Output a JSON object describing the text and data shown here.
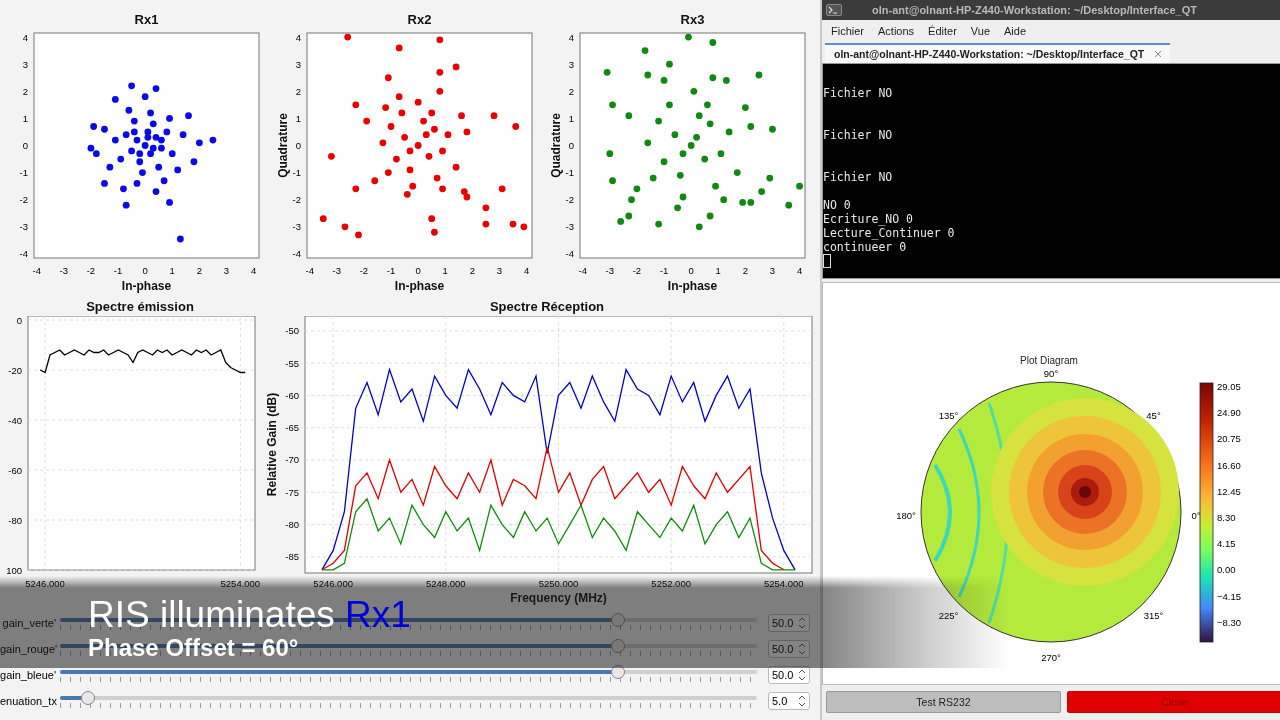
{
  "constellations": [
    {
      "chart_data": {
        "type": "scatter",
        "title": "Rx1",
        "xlabel": "In-phase",
        "xlim": [
          -4.1,
          4.2
        ],
        "ylim": [
          -4.15,
          4.15
        ],
        "xticks": [
          {
            "value": -4,
            "label": "-4"
          },
          {
            "value": -3,
            "label": "-3"
          },
          {
            "value": -2,
            "label": "-2"
          },
          {
            "value": -1,
            "label": "-1"
          },
          {
            "value": 0,
            "label": "0"
          },
          {
            "value": 1,
            "label": "1"
          },
          {
            "value": 2,
            "label": "2"
          },
          {
            "value": 3,
            "label": "3"
          },
          {
            "value": 4,
            "label": "4"
          }
        ],
        "yticks": [
          {
            "value": -4,
            "label": "-4"
          },
          {
            "value": -3,
            "label": "-3"
          },
          {
            "value": -2,
            "label": "-2"
          },
          {
            "value": -1,
            "label": "-1"
          },
          {
            "value": 0,
            "label": "0"
          },
          {
            "value": 1,
            "label": "1"
          },
          {
            "value": 2,
            "label": "2"
          },
          {
            "value": 3,
            "label": "3"
          },
          {
            "value": 4,
            "label": "4"
          }
        ],
        "series": [
          {
            "color": "#0a0ae6",
            "x": [
              0,
              -0.3,
              0.2,
              0.4,
              -0.5,
              0.1,
              -0.2,
              0.6,
              -0.7,
              0.3,
              -0.4,
              0.8,
              -0.9,
              0.5,
              -0.1,
              1.0,
              -1.1,
              0.2,
              -0.6,
              0.9,
              -1.3,
              0.7,
              -0.3,
              1.4,
              -1.5,
              1.2,
              -0.8,
              0.4,
              -0.5,
              0.4,
              -1.1,
              1.6,
              -1.8,
              2.0,
              2.5,
              -2.0,
              1.8,
              -0.7,
              0.9,
              -1.5,
              0.0,
              1.3,
              -1.9,
              0.1,
              -0.2,
              0.3,
              -0.4,
              0.6
            ],
            "values": [
              0,
              0.2,
              -0.3,
              0.3,
              -0.2,
              0.5,
              -0.6,
              -0.1,
              0.4,
              0.8,
              0.9,
              0.5,
              -0.5,
              -0.8,
              -1.0,
              -0.3,
              0.2,
              1.2,
              1.3,
              1.0,
              -0.8,
              -1.3,
              -1.4,
              0.4,
              0.6,
              -0.9,
              -1.6,
              -1.7,
              2.2,
              2.1,
              1.7,
              1.1,
              -0.3,
              0.1,
              0.2,
              -0.1,
              -0.6,
              -2.2,
              -2.1,
              -1.4,
              1.8,
              -3.45,
              0.7,
              0.3,
              -0.3,
              -0.1,
              0.5,
              0.2
            ]
          }
        ]
      }
    },
    {
      "chart_data": {
        "type": "scatter",
        "title": "Rx2",
        "xlabel": "In-phase",
        "ylabel": "Quadrature",
        "xlim": [
          -4.1,
          4.2
        ],
        "ylim": [
          -4.15,
          4.15
        ],
        "xticks": [
          {
            "value": -4,
            "label": "-4"
          },
          {
            "value": -3,
            "label": "-3"
          },
          {
            "value": -2,
            "label": "-2"
          },
          {
            "value": -1,
            "label": "-1"
          },
          {
            "value": 0,
            "label": "0"
          },
          {
            "value": 1,
            "label": "1"
          },
          {
            "value": 2,
            "label": "2"
          },
          {
            "value": 3,
            "label": "3"
          },
          {
            "value": 4,
            "label": "4"
          }
        ],
        "yticks": [
          {
            "value": -4,
            "label": "-4"
          },
          {
            "value": -3,
            "label": "-3"
          },
          {
            "value": -2,
            "label": "-2"
          },
          {
            "value": -1,
            "label": "-1"
          },
          {
            "value": 0,
            "label": "0"
          },
          {
            "value": 1,
            "label": "1"
          },
          {
            "value": 2,
            "label": "2"
          },
          {
            "value": 3,
            "label": "3"
          },
          {
            "value": 4,
            "label": "4"
          }
        ],
        "series": [
          {
            "color": "#e60000",
            "x": [
              0,
              -0.5,
              0.4,
              0.6,
              -0.8,
              0.2,
              -0.3,
              0.9,
              -1.0,
              0.5,
              -0.6,
              1.1,
              -1.1,
              0.7,
              -0.2,
              1.4,
              -1.3,
              0.0,
              -0.7,
              1.6,
              -1.6,
              0.9,
              -0.4,
              1.8,
              -1.9,
              1.7,
              -1.2,
              0.8,
              -1.1,
              0.8,
              1.4,
              -0.7,
              0.8,
              -2.6,
              -2.3,
              -3.2,
              -3.5,
              -2.7,
              -2.2,
              2.8,
              3.6,
              3.1,
              2.5,
              2.5,
              3.5,
              3.9,
              0.5,
              0.6,
              -2.3,
              1.8,
              0.3,
              -0.3
            ],
            "values": [
              0,
              0.3,
              -0.4,
              0.6,
              -0.5,
              0.9,
              -0.9,
              -0.2,
              0.7,
              1.2,
              1.2,
              0.4,
              -1.0,
              -1.2,
              -1.5,
              -0.8,
              0.1,
              1.6,
              1.8,
              1.1,
              -1.3,
              -1.6,
              -1.8,
              0.5,
              0.9,
              -1.7,
              1.4,
              2.0,
              2.5,
              2.7,
              2.9,
              3.6,
              3.9,
              4.0,
              1.5,
              -0.4,
              -2.7,
              -3.0,
              -3.3,
              1.1,
              0.7,
              -1.6,
              -2.3,
              -2.9,
              -2.9,
              -3.0,
              -2.7,
              -3.2,
              -1.6,
              -1.9,
              0.4,
              -0.2
            ]
          }
        ]
      }
    },
    {
      "chart_data": {
        "type": "scatter",
        "title": "Rx3",
        "xlabel": "In-phase",
        "ylabel": "Quadrature",
        "xlim": [
          -4.1,
          4.2
        ],
        "ylim": [
          -4.15,
          4.15
        ],
        "xticks": [
          {
            "value": -4,
            "label": "-4"
          },
          {
            "value": -3,
            "label": "-3"
          },
          {
            "value": -2,
            "label": "-2"
          },
          {
            "value": -1,
            "label": "-1"
          },
          {
            "value": 0,
            "label": "0"
          },
          {
            "value": 1,
            "label": "1"
          },
          {
            "value": 2,
            "label": "2"
          },
          {
            "value": 3,
            "label": "3"
          },
          {
            "value": 4,
            "label": "4"
          }
        ],
        "yticks": [
          {
            "value": -4,
            "label": "-4"
          },
          {
            "value": -3,
            "label": "-3"
          },
          {
            "value": -2,
            "label": "-2"
          },
          {
            "value": -1,
            "label": "-1"
          },
          {
            "value": 0,
            "label": "0"
          },
          {
            "value": 1,
            "label": "1"
          },
          {
            "value": 2,
            "label": "2"
          },
          {
            "value": 3,
            "label": "3"
          },
          {
            "value": 4,
            "label": "4"
          }
        ],
        "series": [
          {
            "color": "#118811",
            "x": [
              0,
              -0.6,
              0.5,
              0.7,
              -1.0,
              0.3,
              -0.4,
              1.1,
              -1.2,
              0.6,
              -0.8,
              1.4,
              -1.4,
              0.9,
              -0.3,
              1.7,
              -1.6,
              0.1,
              -1.0,
              2.0,
              -2.0,
              1.2,
              -0.5,
              2.2,
              -2.3,
              2.2,
              -1.6,
              0.8,
              1.3,
              -0.8,
              0.8,
              -0.1,
              -1.7,
              -3.1,
              -2.9,
              -3.0,
              -2.9,
              -2.6,
              -2.3,
              -1.2,
              0.3,
              0.7,
              2.5,
              3.0,
              2.9,
              3.6,
              4.0,
              1.9,
              -2.2,
              2.6,
              0.2,
              -0.3
            ],
            "values": [
              0,
              0.4,
              -0.5,
              0.8,
              -0.6,
              1.1,
              -1.1,
              -0.3,
              0.9,
              1.5,
              1.5,
              0.5,
              -1.2,
              -1.5,
              -1.9,
              -1.0,
              0.1,
              2.0,
              2.4,
              1.4,
              -1.6,
              -2.0,
              -2.3,
              0.7,
              1.1,
              -2.1,
              2.6,
              2.5,
              2.4,
              3.0,
              3.8,
              4.0,
              3.5,
              2.7,
              1.5,
              -0.3,
              -1.3,
              -2.8,
              -2.6,
              -2.9,
              -3.0,
              -2.6,
              2.6,
              0.6,
              -1.2,
              -2.2,
              -1.5,
              -2.1,
              -2.0,
              -1.7,
              0.3,
              -0.3
            ]
          }
        ]
      }
    }
  ],
  "spectrum_tx": {
    "chart_data": {
      "type": "line",
      "title": "Spectre émission",
      "grid": true,
      "xlim": [
        5245.3,
        5254.6
      ],
      "ylim": [
        -100,
        1.6
      ],
      "xticks": [
        {
          "value": 5246,
          "label": "5246.000"
        },
        {
          "value": 5254,
          "label": "5254.000"
        }
      ],
      "yticks": [
        {
          "value": 0,
          "label": "0"
        },
        {
          "value": -20,
          "label": "-20"
        },
        {
          "value": -40,
          "label": "-40"
        },
        {
          "value": -60,
          "label": "-60"
        },
        {
          "value": -80,
          "label": "-80"
        },
        {
          "value": -100,
          "label": "100"
        }
      ],
      "x": [
        5245.8,
        5246.0,
        5246.2,
        5246.4,
        5246.6,
        5246.8,
        5247.0,
        5247.2,
        5247.4,
        5247.6,
        5247.8,
        5248.0,
        5248.2,
        5248.4,
        5248.6,
        5248.8,
        5249.0,
        5249.2,
        5249.4,
        5249.6,
        5249.8,
        5250.0,
        5250.2,
        5250.4,
        5250.6,
        5250.8,
        5251.0,
        5251.2,
        5251.4,
        5251.6,
        5251.8,
        5252.0,
        5252.2,
        5252.4,
        5252.6,
        5252.8,
        5253.0,
        5253.2,
        5253.4,
        5253.6,
        5253.8,
        5254.0,
        5254.2
      ],
      "series": [
        {
          "color": "#000000",
          "values": [
            -20,
            -21,
            -14,
            -13,
            -12,
            -14,
            -13,
            -12,
            -13,
            -14,
            -12,
            -13,
            -13,
            -12,
            -14,
            -13,
            -12,
            -13,
            -14,
            -17,
            -13,
            -12,
            -13,
            -14,
            -12,
            -13,
            -12,
            -14,
            -13,
            -12,
            -13,
            -14,
            -12,
            -13,
            -12,
            -14,
            -13,
            -12,
            -17,
            -19,
            -20,
            -21,
            -21
          ]
        }
      ]
    }
  },
  "spectrum_rx": {
    "chart_data": {
      "type": "line",
      "title": "Spectre Réception",
      "grid": true,
      "xlabel": "Frequency (MHz)",
      "ylabel": "Relative Gain (dB)",
      "xlim": [
        5245.5,
        5254.5
      ],
      "ylim": [
        -87.5,
        -47.7
      ],
      "xticks": [
        {
          "value": 5246,
          "label": "5246.000"
        },
        {
          "value": 5248,
          "label": "5248.000"
        },
        {
          "value": 5250,
          "label": "5250.000"
        },
        {
          "value": 5252,
          "label": "5252.000"
        },
        {
          "value": 5254,
          "label": "5254.000"
        }
      ],
      "yticks": [
        {
          "value": -50,
          "label": "-50"
        },
        {
          "value": -55,
          "label": "-55"
        },
        {
          "value": -60,
          "label": "-60"
        },
        {
          "value": -65,
          "label": "-65"
        },
        {
          "value": -70,
          "label": "-70"
        },
        {
          "value": -75,
          "label": "-75"
        },
        {
          "value": -80,
          "label": "-80"
        },
        {
          "value": -85,
          "label": "-85"
        }
      ],
      "x": [
        5245.8,
        5246.0,
        5246.2,
        5246.4,
        5246.6,
        5246.8,
        5247.0,
        5247.2,
        5247.4,
        5247.6,
        5247.8,
        5248.0,
        5248.2,
        5248.4,
        5248.6,
        5248.8,
        5249.0,
        5249.2,
        5249.4,
        5249.6,
        5249.8,
        5250.0,
        5250.2,
        5250.4,
        5250.6,
        5250.8,
        5251.0,
        5251.2,
        5251.4,
        5251.6,
        5251.8,
        5252.0,
        5252.2,
        5252.4,
        5252.6,
        5252.8,
        5253.0,
        5253.2,
        5253.4,
        5253.6,
        5253.8,
        5254.0,
        5254.2
      ],
      "series": [
        {
          "color": "#0000cc",
          "values": [
            -87,
            -84,
            -78,
            -62,
            -58,
            -63,
            -56,
            -61,
            -59,
            -64,
            -57,
            -60,
            -62,
            -56,
            -59,
            -63,
            -58,
            -60,
            -61,
            -57,
            -69,
            -60,
            -58,
            -62,
            -57,
            -61,
            -64,
            -56,
            -59,
            -60,
            -63,
            -57,
            -61,
            -58,
            -64,
            -60,
            -57,
            -62,
            -59,
            -72,
            -79,
            -84,
            -87
          ]
        },
        {
          "color": "#dd0000",
          "values": [
            -87,
            -86,
            -84,
            -74,
            -72,
            -76,
            -70,
            -75,
            -73,
            -77,
            -71,
            -74,
            -76,
            -72,
            -75,
            -70,
            -77,
            -73,
            -74,
            -76,
            -68,
            -75,
            -72,
            -77,
            -73,
            -71,
            -76,
            -74,
            -72,
            -75,
            -73,
            -77,
            -71,
            -74,
            -76,
            -72,
            -75,
            -73,
            -71,
            -84,
            -86,
            -87,
            null
          ]
        },
        {
          "color": "#128a12",
          "values": [
            -87,
            -87,
            -86,
            -78,
            -76,
            -81,
            -79,
            -83,
            -77,
            -80,
            -82,
            -78,
            -81,
            -79,
            -84,
            -77,
            -80,
            -82,
            -78,
            -81,
            -79,
            -83,
            -80,
            -77,
            -82,
            -79,
            -81,
            -84,
            -78,
            -80,
            -82,
            -79,
            -81,
            -77,
            -83,
            -80,
            -78,
            -82,
            -79,
            -86,
            -87,
            -87,
            -87
          ]
        }
      ]
    }
  },
  "sliders": [
    {
      "label": "gain_verte'",
      "level": 0.8,
      "value": "50.0"
    },
    {
      "label": "gain_rouge'",
      "level": 0.8,
      "value": "50.0"
    },
    {
      "label": "gain_bleue'",
      "level": 0.8,
      "value": "50.0"
    },
    {
      "label": "enuation_tx",
      "level": 0.04,
      "value": "5.0"
    }
  ],
  "caption": {
    "title": "RIS illuminates",
    "highlight": "Rx1",
    "subtitle": "Phase Offset = 60°"
  },
  "terminal": {
    "title": "oln-ant@olnant-HP-Z440-Workstation: ~/Desktop/Interface_QT",
    "menu": [
      "Fichier",
      "Actions",
      "Éditer",
      "Vue",
      "Aide"
    ],
    "tab": "oln-ant@olnant-HP-Z440-Workstation: ~/Desktop/Interface_QT",
    "blocks": [
      [
        "Fichier NO"
      ],
      [
        "Fichier NO"
      ],
      [
        "Fichier NO"
      ],
      [
        "NO 0",
        "Ecriture_NO 0",
        "Lecture_Continuer 0",
        "continueer 0"
      ]
    ],
    "cursor": true
  },
  "polar_plot": {
    "title": "Plot Diagram",
    "angle_labels": [
      "0°",
      "45°",
      "90°",
      "135°",
      "180°",
      "225°",
      "270°",
      "315°"
    ],
    "colorbar_ticks": [
      "29.05",
      "24.90",
      "20.75",
      "16.60",
      "12.45",
      "8.30",
      "4.15",
      "0.00",
      "−4.15",
      "−8.30"
    ]
  },
  "buttons": [
    {
      "label": "Test RS232",
      "kind": "default"
    },
    {
      "label": "Close",
      "kind": "danger"
    }
  ]
}
